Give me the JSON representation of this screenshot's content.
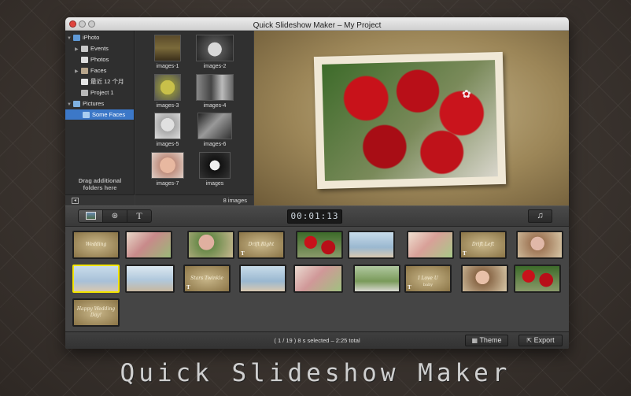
{
  "window": {
    "title": "Quick Slideshow Maker – My Project"
  },
  "sidebar": {
    "items": [
      {
        "label": "iPhoto",
        "icon": "iphoto-icon"
      },
      {
        "label": "Events",
        "icon": "events-icon"
      },
      {
        "label": "Photos",
        "icon": "photos-icon"
      },
      {
        "label": "Faces",
        "icon": "faces-icon"
      },
      {
        "label": "最近 12 个月",
        "icon": "calendar-icon"
      },
      {
        "label": "Project 1",
        "icon": "project-icon"
      },
      {
        "label": "Pictures",
        "icon": "folder-icon"
      },
      {
        "label": "Some Faces",
        "icon": "folder-icon"
      }
    ],
    "drag_hint": "Drag additional folders here"
  },
  "browser": {
    "thumbnails": [
      {
        "label": "images-1"
      },
      {
        "label": "images-2"
      },
      {
        "label": "images-3"
      },
      {
        "label": "images-4"
      },
      {
        "label": "images-5"
      },
      {
        "label": "images-6"
      },
      {
        "label": "images-7"
      },
      {
        "label": "images"
      }
    ],
    "count": "8 images"
  },
  "toolbar": {
    "tabs": [
      {
        "icon": "photo-icon"
      },
      {
        "icon": "film-reel-icon"
      },
      {
        "label": "T",
        "icon": "text-icon"
      }
    ],
    "timecode": "00:01:13",
    "music_icon": "music-note-icon"
  },
  "storyboard": {
    "clips": [
      {
        "kind": "text",
        "text": "Wedding"
      },
      {
        "kind": "photo"
      },
      {
        "kind": "photo"
      },
      {
        "kind": "text",
        "text": "Drift Right",
        "tmark": "T"
      },
      {
        "kind": "photo"
      },
      {
        "kind": "photo"
      },
      {
        "kind": "photo"
      },
      {
        "kind": "text",
        "text": "Drift Left",
        "tmark": "T"
      },
      {
        "kind": "photo"
      },
      {
        "kind": "photo",
        "selected": true
      },
      {
        "kind": "photo"
      },
      {
        "kind": "text",
        "text": "Stars Twinkle",
        "tmark": "T"
      },
      {
        "kind": "photo"
      },
      {
        "kind": "photo"
      },
      {
        "kind": "photo"
      },
      {
        "kind": "text",
        "text": "I Love U",
        "subtext": "baby",
        "tmark": "T"
      },
      {
        "kind": "photo"
      },
      {
        "kind": "photo"
      },
      {
        "kind": "text",
        "text": "Happy Wedding Day!"
      }
    ]
  },
  "status": {
    "text": "( 1 / 19 )  8 s selected – 2:25 total",
    "theme_label": "Theme",
    "export_label": "Export"
  },
  "brand": "Quick Slideshow Maker",
  "colors": {
    "selection": "#3c78c8",
    "clip_selected": "#f2e400",
    "traffic_close": "#e0443e",
    "traffic_min": "#dea123",
    "traffic_max": "#1aab29"
  }
}
